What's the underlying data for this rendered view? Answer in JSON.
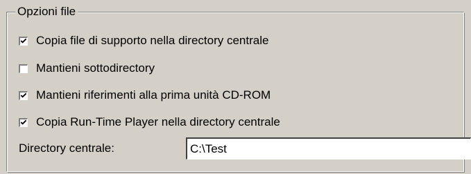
{
  "group": {
    "title": "Opzioni file"
  },
  "options": [
    {
      "label": "Copia file di supporto nella directory centrale",
      "checked": true
    },
    {
      "label": "Mantieni sottodirectory",
      "checked": false
    },
    {
      "label": "Mantieni riferimenti alla prima unità CD-ROM",
      "checked": true
    },
    {
      "label": "Copia Run-Time Player nella directory centrale",
      "checked": true
    }
  ],
  "central_directory": {
    "label": "Directory centrale:",
    "value": "C:\\Test"
  },
  "colors": {
    "face": "#d4d0c8",
    "shadow": "#808080",
    "highlight": "#ffffff"
  }
}
